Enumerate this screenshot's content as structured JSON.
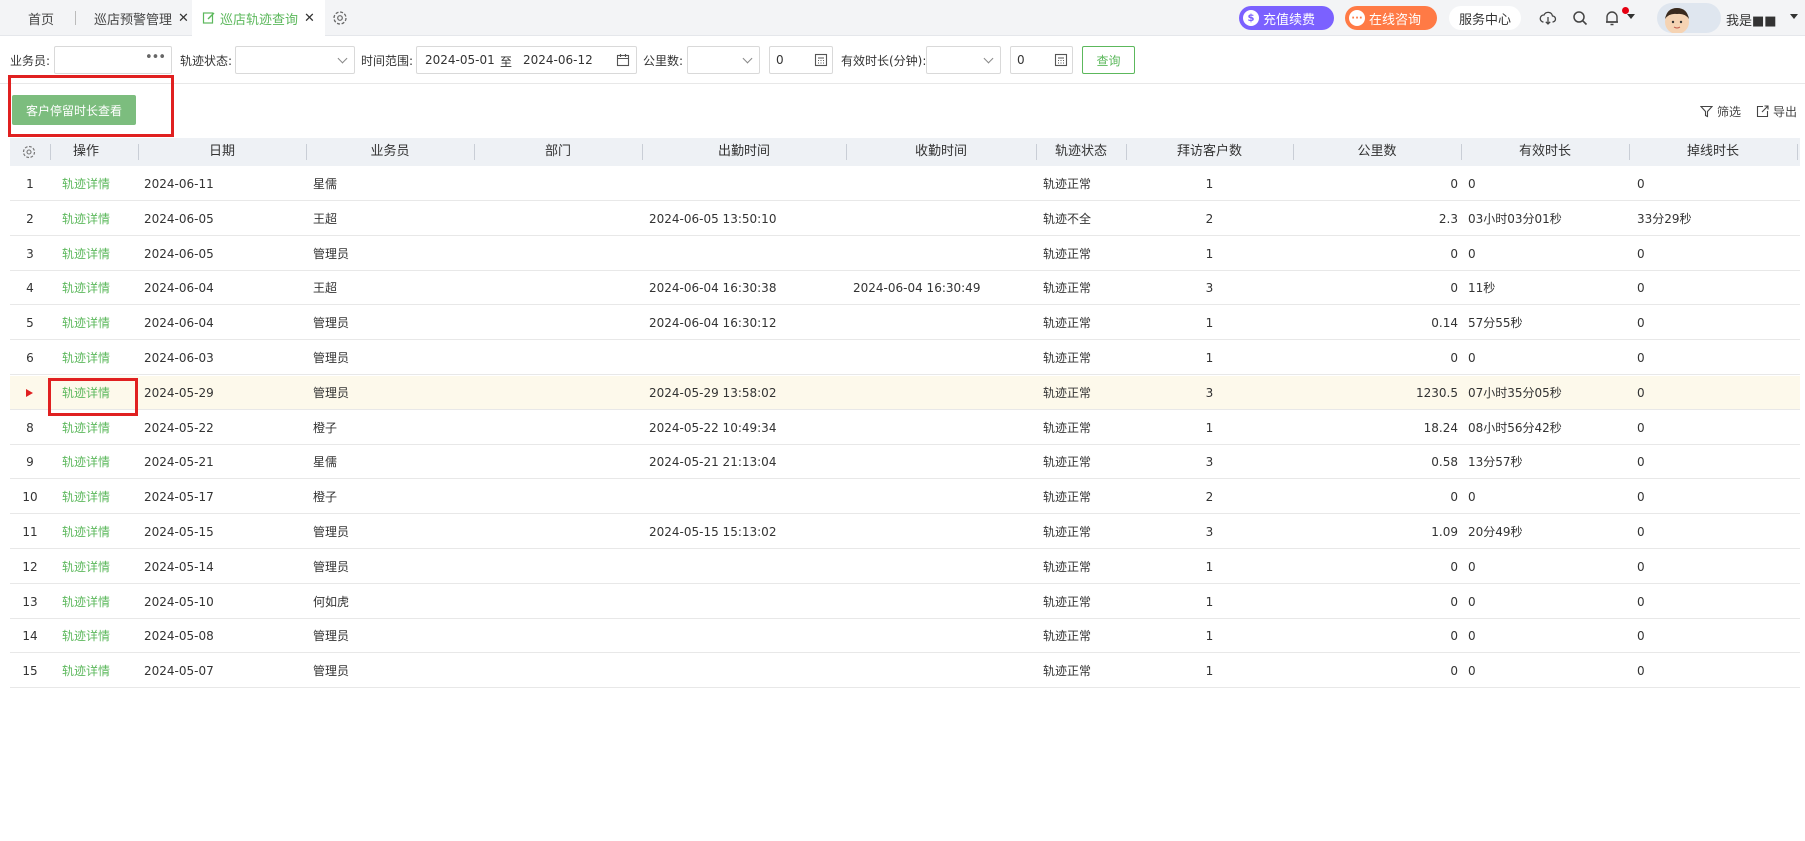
{
  "tabs": [
    {
      "label": "首页",
      "closable": false
    },
    {
      "label": "巡店预警管理",
      "closable": true
    },
    {
      "label": "巡店轨迹查询",
      "closable": true,
      "active": true
    }
  ],
  "header": {
    "recharge_label": "充值续费",
    "consult_label": "在线咨询",
    "service_label": "服务中心",
    "username": "我是■■"
  },
  "filters": {
    "salesman_label": "业务员:",
    "salesman_value": "",
    "status_label": "轨迹状态:",
    "status_value": "",
    "range_label": "时间范围:",
    "date_start": "2024-05-01",
    "date_to": "至",
    "date_end": "2024-06-12",
    "km_label": "公里数:",
    "km_value": "0",
    "duration_label": "有效时长(分钟):",
    "duration_value": "0",
    "query_label": "查询"
  },
  "actions": {
    "stay_button": "客户停留时长查看",
    "filter_label": "筛选",
    "export_label": "导出"
  },
  "table": {
    "columns": [
      "操作",
      "日期",
      "业务员",
      "部门",
      "出勤时间",
      "收勤时间",
      "轨迹状态",
      "拜访客户数",
      "公里数",
      "有效时长",
      "掉线时长"
    ],
    "link_text": "轨迹详情",
    "rows": [
      {
        "no": "1",
        "date": "2024-06-11",
        "salesman": "星儒",
        "dept": "",
        "checkin": "",
        "checkout": "",
        "status": "轨迹正常",
        "visits": "1",
        "km": "0",
        "valid": "0",
        "offline": "0"
      },
      {
        "no": "2",
        "date": "2024-06-05",
        "salesman": "王超",
        "dept": "",
        "checkin": "2024-06-05 13:50:10",
        "checkout": "",
        "status": "轨迹不全",
        "visits": "2",
        "km": "2.3",
        "valid": "03小时03分01秒",
        "offline": "33分29秒"
      },
      {
        "no": "3",
        "date": "2024-06-05",
        "salesman": "管理员",
        "dept": "",
        "checkin": "",
        "checkout": "",
        "status": "轨迹正常",
        "visits": "1",
        "km": "0",
        "valid": "0",
        "offline": "0"
      },
      {
        "no": "4",
        "date": "2024-06-04",
        "salesman": "王超",
        "dept": "",
        "checkin": "2024-06-04 16:30:38",
        "checkout": "2024-06-04 16:30:49",
        "status": "轨迹正常",
        "visits": "3",
        "km": "0",
        "valid": "11秒",
        "offline": "0"
      },
      {
        "no": "5",
        "date": "2024-06-04",
        "salesman": "管理员",
        "dept": "",
        "checkin": "2024-06-04 16:30:12",
        "checkout": "",
        "status": "轨迹正常",
        "visits": "1",
        "km": "0.14",
        "valid": "57分55秒",
        "offline": "0"
      },
      {
        "no": "6",
        "date": "2024-06-03",
        "salesman": "管理员",
        "dept": "",
        "checkin": "",
        "checkout": "",
        "status": "轨迹正常",
        "visits": "1",
        "km": "0",
        "valid": "0",
        "offline": "0"
      },
      {
        "no": "",
        "date": "2024-05-29",
        "salesman": "管理员",
        "dept": "",
        "checkin": "2024-05-29 13:58:02",
        "checkout": "",
        "status": "轨迹正常",
        "visits": "3",
        "km": "1230.5",
        "valid": "07小时35分05秒",
        "offline": "0",
        "selected": true
      },
      {
        "no": "8",
        "date": "2024-05-22",
        "salesman": "橙子",
        "dept": "",
        "checkin": "2024-05-22 10:49:34",
        "checkout": "",
        "status": "轨迹正常",
        "visits": "1",
        "km": "18.24",
        "valid": "08小时56分42秒",
        "offline": "0"
      },
      {
        "no": "9",
        "date": "2024-05-21",
        "salesman": "星儒",
        "dept": "",
        "checkin": "2024-05-21 21:13:04",
        "checkout": "",
        "status": "轨迹正常",
        "visits": "3",
        "km": "0.58",
        "valid": "13分57秒",
        "offline": "0"
      },
      {
        "no": "10",
        "date": "2024-05-17",
        "salesman": "橙子",
        "dept": "",
        "checkin": "",
        "checkout": "",
        "status": "轨迹正常",
        "visits": "2",
        "km": "0",
        "valid": "0",
        "offline": "0"
      },
      {
        "no": "11",
        "date": "2024-05-15",
        "salesman": "管理员",
        "dept": "",
        "checkin": "2024-05-15 15:13:02",
        "checkout": "",
        "status": "轨迹正常",
        "visits": "3",
        "km": "1.09",
        "valid": "20分49秒",
        "offline": "0"
      },
      {
        "no": "12",
        "date": "2024-05-14",
        "salesman": "管理员",
        "dept": "",
        "checkin": "",
        "checkout": "",
        "status": "轨迹正常",
        "visits": "1",
        "km": "0",
        "valid": "0",
        "offline": "0"
      },
      {
        "no": "13",
        "date": "2024-05-10",
        "salesman": "何如虎",
        "dept": "",
        "checkin": "",
        "checkout": "",
        "status": "轨迹正常",
        "visits": "1",
        "km": "0",
        "valid": "0",
        "offline": "0"
      },
      {
        "no": "14",
        "date": "2024-05-08",
        "salesman": "管理员",
        "dept": "",
        "checkin": "",
        "checkout": "",
        "status": "轨迹正常",
        "visits": "1",
        "km": "0",
        "valid": "0",
        "offline": "0"
      },
      {
        "no": "15",
        "date": "2024-05-07",
        "salesman": "管理员",
        "dept": "",
        "checkin": "",
        "checkout": "",
        "status": "轨迹正常",
        "visits": "1",
        "km": "0",
        "valid": "0",
        "offline": "0"
      }
    ]
  },
  "colors": {
    "accent": "#5cb85c",
    "button_fill": "#7cbd7e",
    "highlight": "#e02020",
    "selected_row": "#fdf9eb"
  }
}
